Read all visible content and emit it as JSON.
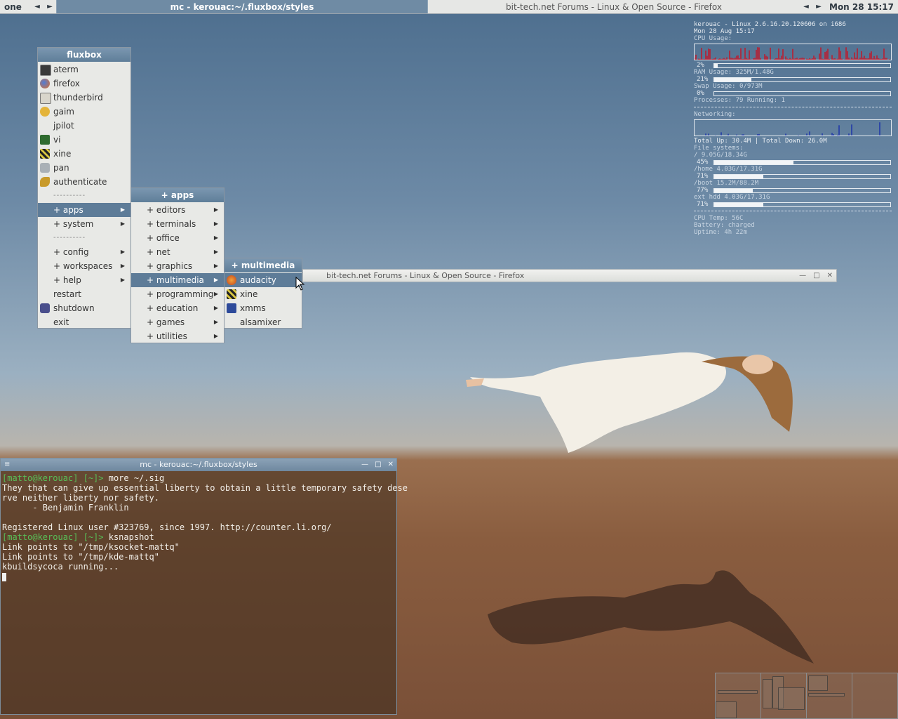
{
  "toolbar": {
    "workspace": "one",
    "active_task": "mc - kerouac:~/.fluxbox/styles",
    "inactive_task": "bit-tech.net Forums - Linux & Open Source - Firefox",
    "clock": "Mon 28 15:17",
    "prev_arrow": "◄",
    "next_arrow": "►"
  },
  "conky": {
    "host_line": "kerouac  - Linux 2.6.16.20.120606 on i686",
    "date_line": "Mon 28 Aug 15:17",
    "cpu_label": "CPU Usage:",
    "cpu_pct": "2%",
    "cpu_value": 0.02,
    "ram_label": "RAM Usage: 325M/1.48G",
    "ram_pct": "21%",
    "ram_value": 0.21,
    "swap_label": "Swap Usage: 0/973M",
    "swap_pct": "0%",
    "swap_value": 0.0,
    "processes": "Processes: 79  Running: 1",
    "net_label": "Networking:",
    "net_totals": " Total Up: 30.4M | Total Down: 26.0M",
    "fs_label": "File systems:",
    "fs": [
      {
        "label": " / 9.05G/18.34G",
        "pct": "45%",
        "value": 0.45
      },
      {
        "label": " /home 4.03G/17.31G",
        "pct": "71%",
        "value": 0.28
      },
      {
        "label": " /boot 15.2M/88.2M",
        "pct": "77%",
        "value": 0.22
      },
      {
        "label": " ext hdd 4.03G/17.31G",
        "pct": "71%",
        "value": 0.28
      }
    ],
    "cpu_temp": "CPU Temp: 56C",
    "battery": "Battery: charged",
    "uptime": "Uptime: 4h 22m",
    "accent_cpu": "#c0182a",
    "accent_net": "#1d35a8"
  },
  "menu_root": {
    "title": "fluxbox",
    "items": [
      {
        "label": "aterm",
        "icon": "terminal-icon"
      },
      {
        "label": "firefox",
        "icon": "firefox-icon"
      },
      {
        "label": "thunderbird",
        "icon": "thunderbird-icon"
      },
      {
        "label": "gaim",
        "icon": "gaim-icon"
      },
      {
        "label": "jpilot",
        "icon": ""
      },
      {
        "label": "vi",
        "icon": "vi-icon"
      },
      {
        "label": "xine",
        "icon": "xine-icon"
      },
      {
        "label": "pan",
        "icon": "pan-icon"
      },
      {
        "label": "authenticate",
        "icon": "keys-icon"
      }
    ],
    "separator": "----------",
    "sub_items": [
      {
        "label": "+ apps"
      },
      {
        "label": "+ system"
      }
    ],
    "sub_items2": [
      {
        "label": "+ config"
      },
      {
        "label": "+ workspaces"
      },
      {
        "label": "+ help"
      }
    ],
    "tail_items": [
      {
        "label": "restart"
      },
      {
        "label": "shutdown"
      },
      {
        "label": "exit"
      }
    ]
  },
  "menu_apps": {
    "title": "+ apps",
    "items": [
      {
        "label": "+ editors"
      },
      {
        "label": "+ terminals"
      },
      {
        "label": "+ office"
      },
      {
        "label": "+ net"
      },
      {
        "label": "+ graphics"
      },
      {
        "label": "+ multimedia"
      },
      {
        "label": "+ programming"
      },
      {
        "label": "+ education"
      },
      {
        "label": "+ games"
      },
      {
        "label": "+ utilities"
      }
    ]
  },
  "menu_multimedia": {
    "title": "+ multimedia",
    "items": [
      {
        "label": "audacity"
      },
      {
        "label": "xine"
      },
      {
        "label": "xmms"
      },
      {
        "label": "alsamixer"
      }
    ]
  },
  "firefox_window": {
    "title": "bit-tech.net Forums - Linux & Open Source - Firefox"
  },
  "terminal": {
    "title": "mc - kerouac:~/.fluxbox/styles",
    "prompt1": "[matto@kerouac] [~]>",
    "cmd1": " more ~/.sig",
    "line1": "They that can give up essential liberty to obtain a little temporary safety dese",
    "line2": "rve neither liberty nor safety.",
    "line3": "      - Benjamin Franklin",
    "line4": "",
    "line5": "Registered Linux user #323769, since 1997. http://counter.li.org/",
    "prompt2": "[matto@kerouac] [~]>",
    "cmd2": " ksnapshot",
    "line6": "Link points to \"/tmp/ksocket-mattq\"",
    "line7": "Link points to \"/tmp/kde-mattq\"",
    "line8": "kbuildsycoca running..."
  }
}
